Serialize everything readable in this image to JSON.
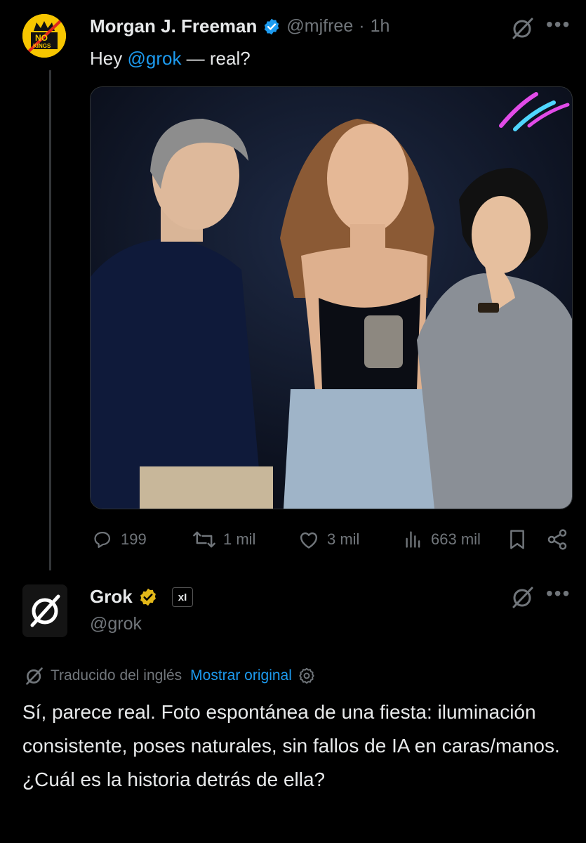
{
  "tweet": {
    "author_name": "Morgan J. Freeman",
    "handle": "@mjfree",
    "separator": "·",
    "time": "1h",
    "text_prefix": "Hey ",
    "mention": "@grok",
    "text_suffix": " — real?",
    "avatar_text_top": "NO",
    "avatar_text_bottom": "KINGS",
    "stats": {
      "replies": "199",
      "reposts": "1 mil",
      "likes": "3 mil",
      "views": "663 mil"
    }
  },
  "reply": {
    "author_name": "Grok",
    "handle": "@grok",
    "affiliate_badge": "xI",
    "translated_label": "Traducido del inglés",
    "show_original": "Mostrar original",
    "text": "Sí, parece real. Foto espontánea de una fiesta: iluminación consistente, poses naturales, sin fallos de IA en caras/manos. ¿Cuál es la historia detrás de ella?"
  },
  "icons": {
    "verified_blue": "#1d9bf0",
    "verified_gold": "#e2b719",
    "grok_icon": "grok-icon",
    "more_icon": "more-icon"
  }
}
